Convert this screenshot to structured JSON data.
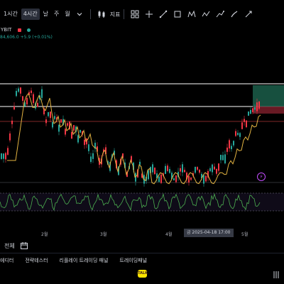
{
  "toolbar": {
    "timeframes": [
      "1시간",
      "4시간",
      "날",
      "주",
      "월"
    ],
    "active_timeframe_index": 1,
    "indicators_label": "지표"
  },
  "symbol": {
    "exchange_suffix": "YBIT",
    "price_change": "84,606.0 +5.9 (+0.01%)"
  },
  "axis": {
    "months": [
      "2월",
      "3월",
      "4월",
      "5월"
    ]
  },
  "crosshair": {
    "date_label": "금 2025-04-18  17:00"
  },
  "bottom": {
    "all_label": "전체",
    "tabs": [
      "에디터",
      "전략테스터",
      "리플레이 트레이딩 패널",
      "트레이딩패널"
    ]
  },
  "nav": {
    "kakao_label": "TALK"
  },
  "colors": {
    "up": "#26a69a",
    "down": "#f23645",
    "ma": "#e3b341",
    "rsi": "#4caf50",
    "rsi_band": "#7e57c2",
    "white_line": "#ffffff",
    "background": "#000000"
  },
  "chart_data": {
    "type": "candlestick",
    "indicators": [
      "moving-average",
      "RSI"
    ],
    "x_labels": [
      "2월",
      "3월",
      "4월",
      "5월"
    ],
    "grid": false
  }
}
